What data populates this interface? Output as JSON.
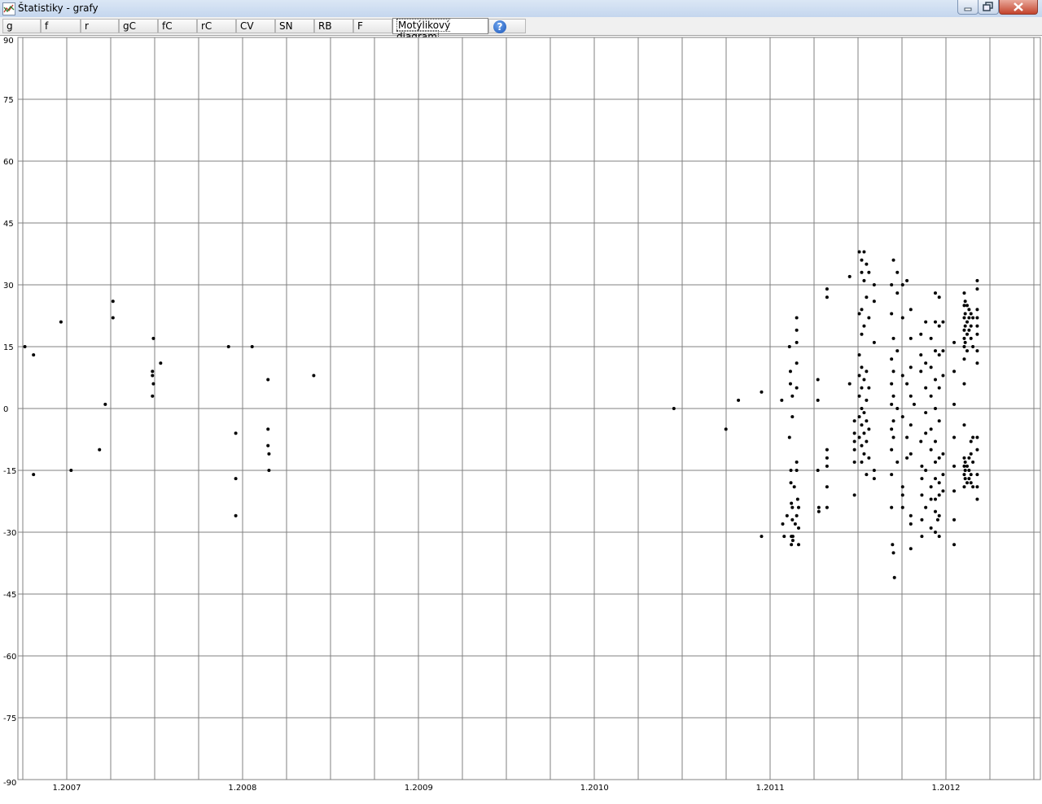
{
  "window": {
    "title": "Štatistiky - grafy"
  },
  "tabs": [
    {
      "label": "g",
      "active": false
    },
    {
      "label": "f",
      "active": false
    },
    {
      "label": "r",
      "active": false
    },
    {
      "label": "gC",
      "active": false
    },
    {
      "label": "fC",
      "active": false
    },
    {
      "label": "rC",
      "active": false
    },
    {
      "label": "CV",
      "active": false
    },
    {
      "label": "SN",
      "active": false
    },
    {
      "label": "RB",
      "active": false
    },
    {
      "label": "F",
      "active": false
    },
    {
      "label": "Motýlikový diagram",
      "active": true
    }
  ],
  "help": {
    "icon": "help-icon",
    "label": "?"
  },
  "chart_data": {
    "type": "scatter",
    "title": "",
    "xlabel": "",
    "ylabel": "",
    "ylim": [
      -90,
      90
    ],
    "yticks": [
      90,
      75,
      60,
      45,
      30,
      15,
      0,
      -15,
      -30,
      -45,
      -60,
      -75,
      -90
    ],
    "xlim": [
      "2006-10",
      "2012-06"
    ],
    "xtick_labels": [
      "1.2007",
      "1.2008",
      "1.2009",
      "1.2010",
      "1.2011",
      "1.2012"
    ],
    "grid": true,
    "point_color": "#000000",
    "points": [
      [
        "2006-10-06",
        15
      ],
      [
        "2006-10-24",
        13
      ],
      [
        "2006-10-24",
        -16
      ],
      [
        "2006-12-20",
        21
      ],
      [
        "2007-01-10",
        -15
      ],
      [
        "2007-03-10",
        -10
      ],
      [
        "2007-03-22",
        1
      ],
      [
        "2007-04-07",
        26
      ],
      [
        "2007-04-07",
        22
      ],
      [
        "2007-06-30",
        17
      ],
      [
        "2007-06-28",
        9
      ],
      [
        "2007-06-28",
        8
      ],
      [
        "2007-06-30",
        6
      ],
      [
        "2007-06-28",
        3
      ],
      [
        "2007-07-15",
        11
      ],
      [
        "2007-12-03",
        15
      ],
      [
        "2007-12-18",
        -6
      ],
      [
        "2007-12-18",
        -17
      ],
      [
        "2007-12-18",
        -26
      ],
      [
        "2008-01-21",
        15
      ],
      [
        "2008-02-23",
        7
      ],
      [
        "2008-02-23",
        -5
      ],
      [
        "2008-02-23",
        -9
      ],
      [
        "2008-02-25",
        -11
      ],
      [
        "2008-02-25",
        -15
      ],
      [
        "2008-05-28",
        8
      ],
      [
        "2010-06-15",
        0
      ],
      [
        "2010-10-01",
        -5
      ],
      [
        "2010-10-27",
        2
      ],
      [
        "2010-12-14",
        4
      ],
      [
        "2010-12-14",
        -31
      ],
      [
        "2011-01-25",
        2
      ],
      [
        "2011-01-27",
        -28
      ],
      [
        "2011-01-30",
        -31
      ],
      [
        "2011-02-05",
        -26
      ],
      [
        "2011-02-10",
        15
      ],
      [
        "2011-02-10",
        -7
      ],
      [
        "2011-02-12",
        9
      ],
      [
        "2011-02-12",
        6
      ],
      [
        "2011-02-13",
        -15
      ],
      [
        "2011-02-13",
        -18
      ],
      [
        "2011-02-14",
        -23
      ],
      [
        "2011-02-14",
        -31
      ],
      [
        "2011-02-14",
        -33
      ],
      [
        "2011-02-16",
        3
      ],
      [
        "2011-02-16",
        -2
      ],
      [
        "2011-02-16",
        -24
      ],
      [
        "2011-02-16",
        -27
      ],
      [
        "2011-02-17",
        -31
      ],
      [
        "2011-02-17",
        -32
      ],
      [
        "2011-02-20",
        -19
      ],
      [
        "2011-02-22",
        -28
      ],
      [
        "2011-02-25",
        22
      ],
      [
        "2011-02-25",
        19
      ],
      [
        "2011-02-25",
        16
      ],
      [
        "2011-02-25",
        11
      ],
      [
        "2011-02-25",
        5
      ],
      [
        "2011-02-25",
        -13
      ],
      [
        "2011-02-25",
        -15
      ],
      [
        "2011-02-25",
        -26
      ],
      [
        "2011-02-27",
        -22
      ],
      [
        "2011-03-01",
        -24
      ],
      [
        "2011-03-01",
        -29
      ],
      [
        "2011-03-01",
        -33
      ],
      [
        "2011-04-10",
        7
      ],
      [
        "2011-04-10",
        2
      ],
      [
        "2011-04-10",
        -15
      ],
      [
        "2011-04-12",
        -24
      ],
      [
        "2011-04-12",
        -25
      ],
      [
        "2011-04-29",
        27
      ],
      [
        "2011-04-29",
        29
      ],
      [
        "2011-04-29",
        -10
      ],
      [
        "2011-04-29",
        -12
      ],
      [
        "2011-04-29",
        -14
      ],
      [
        "2011-04-29",
        -19
      ],
      [
        "2011-04-29",
        -24
      ],
      [
        "2011-06-15",
        32
      ],
      [
        "2011-06-15",
        6
      ],
      [
        "2011-06-25",
        -21
      ],
      [
        "2011-06-25",
        -3
      ],
      [
        "2011-06-25",
        -6
      ],
      [
        "2011-06-25",
        -8
      ],
      [
        "2011-06-25",
        -10
      ],
      [
        "2011-06-25",
        -13
      ],
      [
        "2011-07-05",
        38
      ],
      [
        "2011-07-05",
        23
      ],
      [
        "2011-07-05",
        13
      ],
      [
        "2011-07-05",
        8
      ],
      [
        "2011-07-05",
        3
      ],
      [
        "2011-07-05",
        -2
      ],
      [
        "2011-07-05",
        -7
      ],
      [
        "2011-07-10",
        36
      ],
      [
        "2011-07-10",
        33
      ],
      [
        "2011-07-10",
        24
      ],
      [
        "2011-07-10",
        18
      ],
      [
        "2011-07-10",
        10
      ],
      [
        "2011-07-10",
        5
      ],
      [
        "2011-07-10",
        0
      ],
      [
        "2011-07-10",
        -4
      ],
      [
        "2011-07-10",
        -9
      ],
      [
        "2011-07-10",
        -13
      ],
      [
        "2011-07-15",
        38
      ],
      [
        "2011-07-15",
        31
      ],
      [
        "2011-07-15",
        20
      ],
      [
        "2011-07-15",
        7
      ],
      [
        "2011-07-15",
        -1
      ],
      [
        "2011-07-15",
        -6
      ],
      [
        "2011-07-15",
        -11
      ],
      [
        "2011-07-20",
        35
      ],
      [
        "2011-07-20",
        27
      ],
      [
        "2011-07-20",
        9
      ],
      [
        "2011-07-20",
        2
      ],
      [
        "2011-07-20",
        -3
      ],
      [
        "2011-07-20",
        -8
      ],
      [
        "2011-07-20",
        -16
      ],
      [
        "2011-07-25",
        33
      ],
      [
        "2011-07-25",
        22
      ],
      [
        "2011-07-25",
        5
      ],
      [
        "2011-07-25",
        -5
      ],
      [
        "2011-07-25",
        -12
      ],
      [
        "2011-08-05",
        30
      ],
      [
        "2011-08-05",
        26
      ],
      [
        "2011-08-05",
        16
      ],
      [
        "2011-08-05",
        -15
      ],
      [
        "2011-08-05",
        -17
      ],
      [
        "2011-09-10",
        30
      ],
      [
        "2011-09-10",
        23
      ],
      [
        "2011-09-10",
        12
      ],
      [
        "2011-09-10",
        6
      ],
      [
        "2011-09-10",
        1
      ],
      [
        "2011-09-10",
        -5
      ],
      [
        "2011-09-10",
        -10
      ],
      [
        "2011-09-10",
        -16
      ],
      [
        "2011-09-10",
        -24
      ],
      [
        "2011-09-12",
        -33
      ],
      [
        "2011-09-14",
        36
      ],
      [
        "2011-09-14",
        17
      ],
      [
        "2011-09-14",
        9
      ],
      [
        "2011-09-14",
        3
      ],
      [
        "2011-09-14",
        -3
      ],
      [
        "2011-09-14",
        -7
      ],
      [
        "2011-09-14",
        -35
      ],
      [
        "2011-09-16",
        -41
      ],
      [
        "2011-09-22",
        33
      ],
      [
        "2011-09-22",
        28
      ],
      [
        "2011-09-22",
        14
      ],
      [
        "2011-09-22",
        0
      ],
      [
        "2011-09-22",
        -13
      ],
      [
        "2011-10-03",
        30
      ],
      [
        "2011-10-03",
        22
      ],
      [
        "2011-10-03",
        8
      ],
      [
        "2011-10-03",
        -2
      ],
      [
        "2011-10-03",
        -19
      ],
      [
        "2011-10-03",
        -21
      ],
      [
        "2011-10-03",
        -24
      ],
      [
        "2011-10-12",
        31
      ],
      [
        "2011-10-12",
        6
      ],
      [
        "2011-10-12",
        -7
      ],
      [
        "2011-10-12",
        -12
      ],
      [
        "2011-10-20",
        24
      ],
      [
        "2011-10-20",
        17
      ],
      [
        "2011-10-20",
        10
      ],
      [
        "2011-10-20",
        3
      ],
      [
        "2011-10-20",
        -4
      ],
      [
        "2011-10-20",
        -11
      ],
      [
        "2011-10-20",
        -26
      ],
      [
        "2011-10-20",
        -28
      ],
      [
        "2011-10-20",
        -34
      ],
      [
        "2011-10-27",
        1
      ],
      [
        "2011-11-10",
        18
      ],
      [
        "2011-11-10",
        13
      ],
      [
        "2011-11-10",
        9
      ],
      [
        "2011-11-10",
        -8
      ],
      [
        "2011-11-12",
        -14
      ],
      [
        "2011-11-12",
        -17
      ],
      [
        "2011-11-12",
        -21
      ],
      [
        "2011-11-12",
        -27
      ],
      [
        "2011-11-12",
        -31
      ],
      [
        "2011-11-20",
        21
      ],
      [
        "2011-11-20",
        11
      ],
      [
        "2011-11-20",
        5
      ],
      [
        "2011-11-20",
        -1
      ],
      [
        "2011-11-20",
        -6
      ],
      [
        "2011-11-20",
        -15
      ],
      [
        "2011-11-20",
        -24
      ],
      [
        "2011-12-01",
        17
      ],
      [
        "2011-12-01",
        10
      ],
      [
        "2011-12-01",
        3
      ],
      [
        "2011-12-01",
        -5
      ],
      [
        "2011-12-01",
        -10
      ],
      [
        "2011-12-01",
        -19
      ],
      [
        "2011-12-01",
        -22
      ],
      [
        "2011-12-01",
        -29
      ],
      [
        "2011-12-10",
        28
      ],
      [
        "2011-12-10",
        21
      ],
      [
        "2011-12-10",
        14
      ],
      [
        "2011-12-10",
        7
      ],
      [
        "2011-12-10",
        0
      ],
      [
        "2011-12-10",
        -8
      ],
      [
        "2011-12-10",
        -13
      ],
      [
        "2011-12-10",
        -17
      ],
      [
        "2011-12-10",
        -22
      ],
      [
        "2011-12-10",
        -25
      ],
      [
        "2011-12-10",
        -30
      ],
      [
        "2011-12-15",
        -27
      ],
      [
        "2011-12-18",
        27
      ],
      [
        "2011-12-18",
        20
      ],
      [
        "2011-12-18",
        13
      ],
      [
        "2011-12-18",
        5
      ],
      [
        "2011-12-18",
        -3
      ],
      [
        "2011-12-18",
        -12
      ],
      [
        "2011-12-18",
        -18
      ],
      [
        "2011-12-18",
        -21
      ],
      [
        "2011-12-18",
        -26
      ],
      [
        "2011-12-18",
        -31
      ],
      [
        "2011-12-26",
        21
      ],
      [
        "2011-12-26",
        14
      ],
      [
        "2011-12-26",
        8
      ],
      [
        "2011-12-26",
        -11
      ],
      [
        "2011-12-26",
        -16
      ],
      [
        "2011-12-26",
        -20
      ],
      [
        "2012-01-18",
        16
      ],
      [
        "2012-01-18",
        9
      ],
      [
        "2012-01-18",
        1
      ],
      [
        "2012-01-18",
        -7
      ],
      [
        "2012-01-18",
        -14
      ],
      [
        "2012-01-18",
        -20
      ],
      [
        "2012-01-18",
        -27
      ],
      [
        "2012-01-18",
        -33
      ],
      [
        "2012-02-08",
        28
      ],
      [
        "2012-02-08",
        25
      ],
      [
        "2012-02-08",
        22
      ],
      [
        "2012-02-08",
        19
      ],
      [
        "2012-02-08",
        17
      ],
      [
        "2012-02-08",
        15
      ],
      [
        "2012-02-08",
        12
      ],
      [
        "2012-02-08",
        6
      ],
      [
        "2012-02-08",
        -4
      ],
      [
        "2012-02-08",
        -12
      ],
      [
        "2012-02-08",
        -14
      ],
      [
        "2012-02-08",
        -16
      ],
      [
        "2012-02-08",
        -19
      ],
      [
        "2012-02-10",
        26
      ],
      [
        "2012-02-10",
        23
      ],
      [
        "2012-02-10",
        20
      ],
      [
        "2012-02-10",
        16
      ],
      [
        "2012-02-10",
        -13
      ],
      [
        "2012-02-10",
        -15
      ],
      [
        "2012-02-10",
        -17
      ],
      [
        "2012-02-14",
        25
      ],
      [
        "2012-02-14",
        21
      ],
      [
        "2012-02-14",
        18
      ],
      [
        "2012-02-14",
        14
      ],
      [
        "2012-02-14",
        -14
      ],
      [
        "2012-02-14",
        -18
      ],
      [
        "2012-02-18",
        24
      ],
      [
        "2012-02-18",
        22
      ],
      [
        "2012-02-18",
        19
      ],
      [
        "2012-02-18",
        -12
      ],
      [
        "2012-02-18",
        -15
      ],
      [
        "2012-02-18",
        -17
      ],
      [
        "2012-02-22",
        23
      ],
      [
        "2012-02-22",
        20
      ],
      [
        "2012-02-22",
        17
      ],
      [
        "2012-02-22",
        -8
      ],
      [
        "2012-02-22",
        -11
      ],
      [
        "2012-02-22",
        -16
      ],
      [
        "2012-02-22",
        -18
      ],
      [
        "2012-02-26",
        22
      ],
      [
        "2012-02-26",
        15
      ],
      [
        "2012-02-26",
        -7
      ],
      [
        "2012-02-26",
        -13
      ],
      [
        "2012-02-26",
        -19
      ],
      [
        "2012-03-06",
        31
      ],
      [
        "2012-03-06",
        29
      ],
      [
        "2012-03-06",
        24
      ],
      [
        "2012-03-06",
        22
      ],
      [
        "2012-03-06",
        20
      ],
      [
        "2012-03-06",
        18
      ],
      [
        "2012-03-06",
        14
      ],
      [
        "2012-03-06",
        11
      ],
      [
        "2012-03-06",
        -7
      ],
      [
        "2012-03-06",
        -10
      ],
      [
        "2012-03-06",
        -16
      ],
      [
        "2012-03-06",
        -19
      ],
      [
        "2012-03-06",
        -22
      ]
    ]
  }
}
